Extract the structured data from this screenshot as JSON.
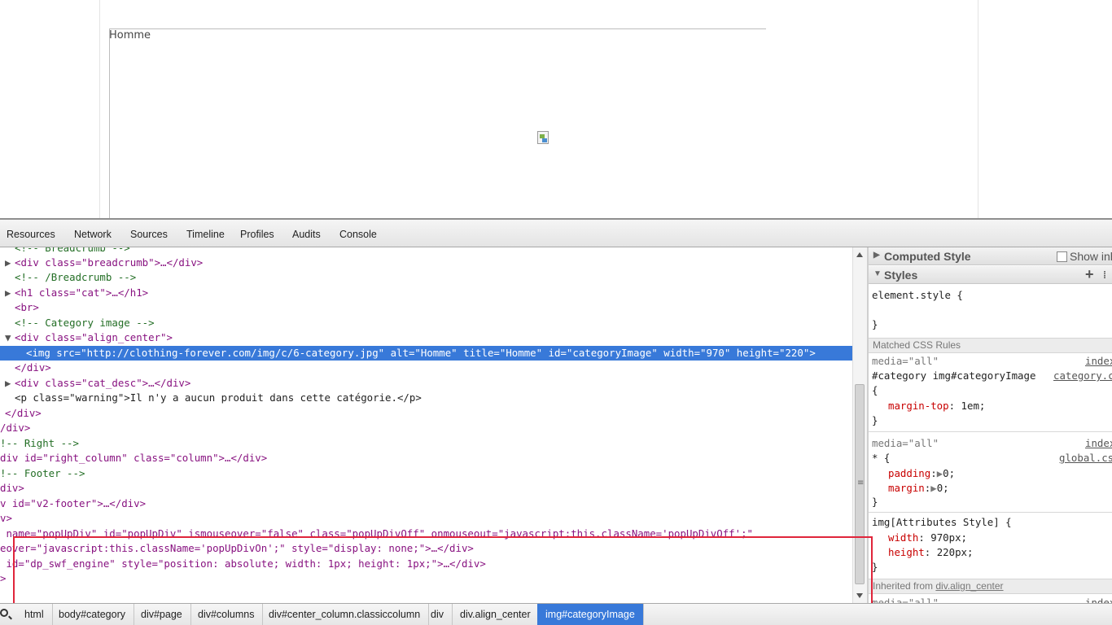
{
  "preview": {
    "image_alt": "Homme"
  },
  "devtools": {
    "tabs": [
      "Resources",
      "Network",
      "Sources",
      "Timeline",
      "Profiles",
      "Audits",
      "Console"
    ],
    "dom_lines": [
      {
        "text": "<!-- Breadcrumb -->"
      },
      {
        "text": "<div class=\"breadcrumb\">…</div>"
      },
      {
        "text": "<!-- /Breadcrumb -->"
      },
      {
        "text": "<h1 class=\"cat\">…</h1>"
      },
      {
        "text": "<br>"
      },
      {
        "text": "<!-- Category image -->"
      },
      {
        "text": "<div class=\"align_center\">"
      },
      {
        "text": "<img src=\"http://clothing-forever.com/img/c/6-category.jpg\" alt=\"Homme\" title=\"Homme\" id=\"categoryImage\" width=\"970\" height=\"220\">"
      },
      {
        "text": "</div>"
      },
      {
        "text": "<div class=\"cat_desc\">…</div>"
      },
      {
        "text": "<p class=\"warning\">Il n'y a aucun produit dans cette catégorie.</p>"
      },
      {
        "text": "</div>"
      },
      {
        "text": "/div>"
      },
      {
        "text": "!-- Right -->"
      },
      {
        "text": "div id=\"right_column\" class=\"column\">…</div>"
      },
      {
        "text": "!-- Footer -->"
      },
      {
        "text": "div>"
      },
      {
        "text": "v id=\"v2-footer\">…</div>"
      },
      {
        "text": "v>"
      },
      {
        "text": " name=\"popUpDiv\" id=\"popUpDiv\" ismouseover=\"false\" class=\"popUpDivOff\" onmouseout=\"javascript:this.className='popUpDivOff';\""
      },
      {
        "text": "eover=\"javascript:this.className='popUpDivOn';\" style=\"display: none;\">…</div>"
      },
      {
        "text": " id=\"dp_swf_engine\" style=\"position: absolute; width: 1px; height: 1px;\">…</div>"
      },
      {
        "text": ">"
      }
    ],
    "styles": {
      "computed_style_label": "Computed Style",
      "show_inherited_label": "Show inh",
      "styles_label": "Styles",
      "element_style_selector": "element.style {",
      "element_style_close": "}",
      "matched_rules_label": "Matched CSS Rules",
      "rule1": {
        "media": "media=\"all\"",
        "source1": "index",
        "selector": "#category img#categoryImage",
        "source2": "category.c",
        "open": "{",
        "decl1_prop": "margin-top",
        "decl1_val": "1em;",
        "close": "}"
      },
      "rule2": {
        "media": "media=\"all\"",
        "source1": "index",
        "selector": "* {",
        "source2": "global.cs",
        "decl1_prop": "padding",
        "decl1_val": "0;",
        "decl2_prop": "margin",
        "decl2_val": "0;",
        "close": "}"
      },
      "rule3": {
        "selector": "img[Attributes Style] {",
        "decl1_prop": "width",
        "decl1_val": "970px;",
        "decl2_prop": "height",
        "decl2_val": "220px;",
        "close": "}"
      },
      "inherited_label": "Inherited from ",
      "inherited_link": "div.align_center",
      "rule4": {
        "media": "media=\"all\"",
        "source": "index"
      }
    },
    "breadcrumbs": [
      "html",
      "body#category",
      "div#page",
      "div#columns",
      "div#center_column.classiccolumn",
      "div",
      "div.align_center",
      "img#categoryImage"
    ]
  },
  "colors": {
    "selection": "#3879d9",
    "highlight_box": "#e0253b",
    "tag": "#881280",
    "attribute": "#994500",
    "value": "#1a1aa6",
    "comment": "#236e25"
  }
}
